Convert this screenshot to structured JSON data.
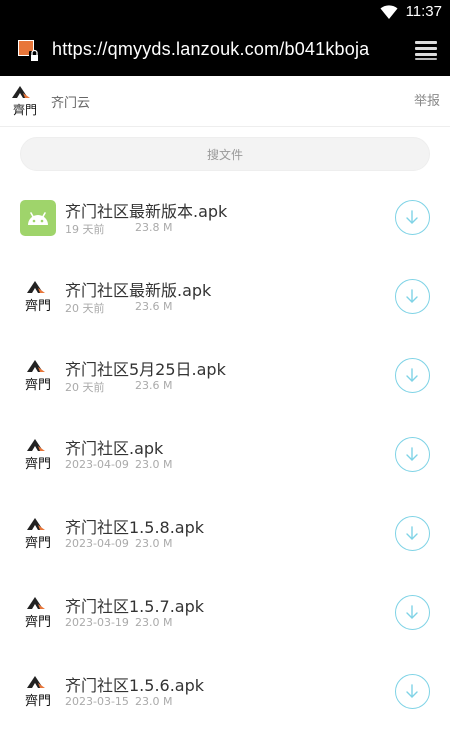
{
  "status_bar": {
    "time": "11:37"
  },
  "browser": {
    "url": "https://qmyyds.lanzouk.com/b041kboja"
  },
  "site": {
    "name": "齐门云",
    "report": "举报",
    "logo_text": "齊門"
  },
  "search": {
    "placeholder": "搜文件"
  },
  "files": [
    {
      "name": "齐门社区最新版本.apk",
      "date": "19 天前",
      "size": "23.8 M",
      "icon": "android-icon"
    },
    {
      "name": "齐门社区最新版.apk",
      "date": "20 天前",
      "size": "23.6 M",
      "icon": "qimen-logo-icon"
    },
    {
      "name": "齐门社区5月25日.apk",
      "date": "20 天前",
      "size": "23.6 M",
      "icon": "qimen-logo-icon"
    },
    {
      "name": "齐门社区.apk",
      "date": "2023-04-09",
      "size": "23.0 M",
      "icon": "qimen-logo-icon"
    },
    {
      "name": "齐门社区1.5.8.apk",
      "date": "2023-04-09",
      "size": "23.0 M",
      "icon": "qimen-logo-icon"
    },
    {
      "name": "齐门社区1.5.7.apk",
      "date": "2023-03-19",
      "size": "23.0 M",
      "icon": "qimen-logo-icon"
    },
    {
      "name": "齐门社区1.5.6.apk",
      "date": "2023-03-15",
      "size": "23.0 M",
      "icon": "qimen-logo-icon"
    }
  ],
  "colors": {
    "accent": "#7fd3e6",
    "android_green": "#9fd46b",
    "logo_orange": "#e8763a"
  }
}
